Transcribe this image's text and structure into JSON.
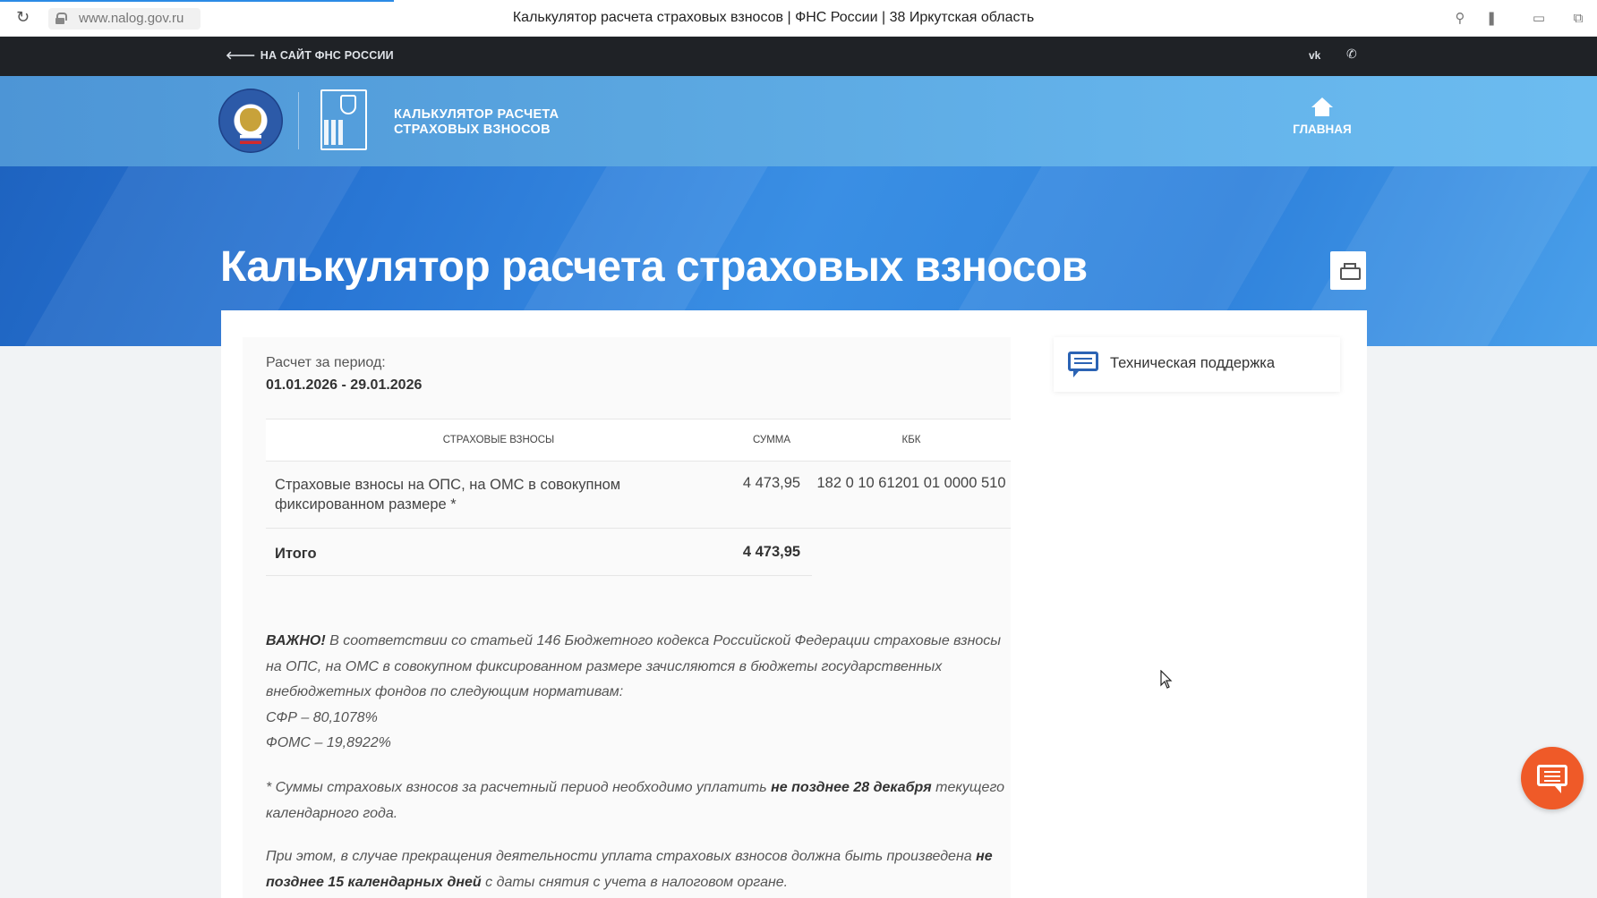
{
  "browser": {
    "url": "www.nalog.gov.ru",
    "title": "Калькулятор расчета страховых взносов | ФНС России | 38 Иркутская область"
  },
  "topbar": {
    "back_link": "НА САЙТ ФНС РОССИИ",
    "vk_label": "VK"
  },
  "header": {
    "brand_line1": "КАЛЬКУЛЯТОР РАСЧЕТА",
    "brand_line2": "СТРАХОВЫХ ВЗНОСОВ",
    "home_label": "ГЛАВНАЯ"
  },
  "hero": {
    "title": "Калькулятор расчета страховых взносов"
  },
  "calc": {
    "period_label": "Расчет за период:",
    "period_value": "01.01.2026 - 29.01.2026",
    "columns": [
      "Страховые взносы",
      "Сумма",
      "КБК"
    ],
    "rows": [
      {
        "name": "Страховые взносы на ОПС, на ОМС в совокупном фиксированном размере *",
        "sum": "4 473,95",
        "kbk": "182 0 10 61201 01 0000 510"
      }
    ],
    "total_label": "Итого",
    "total_sum": "4 473,95"
  },
  "notes": {
    "important_bold": "ВАЖНО!",
    "important_text": " В соответствии со статьей 146 Бюджетного кодекса Российской Федерации страховые взносы на ОПС, на ОМС в совокупном фиксированном размере зачисляются в бюджеты государственных внебюджетных фондов по следующим нормативам:",
    "sfr": "СФР – 80,1078%",
    "foms": "ФОМС – 19,8922%",
    "deadline_pre": "* Суммы страховых взносов за расчетный период необходимо уплатить ",
    "deadline_bold": "не позднее 28 декабря",
    "deadline_post": " текущего календарного года.",
    "termination_pre": "При этом, в случае прекращения деятельности уплата страховых взносов должна быть произведена ",
    "termination_bold": "не позднее 15 календарных дней",
    "termination_post": " с даты снятия с учета в налоговом органе."
  },
  "sidebar": {
    "support_label": "Техническая поддержка"
  },
  "colors": {
    "topbar_bg": "#1f2226",
    "header_blue": "#5aa6e0",
    "hero_blue": "#2a78d6",
    "chat_orange": "#ef5a28",
    "support_icon": "#2b63b4"
  },
  "icons": {
    "reload": "reload-icon",
    "lock": "lock-icon",
    "back": "arrow-left-icon",
    "phone": "phone-icon",
    "home": "home-icon",
    "print": "printer-icon",
    "support": "chat-bubble-icon",
    "chat": "chat-icon"
  }
}
